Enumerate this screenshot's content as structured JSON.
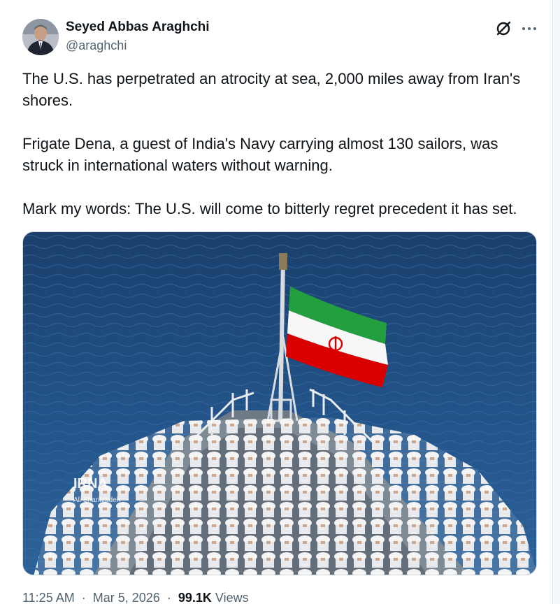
{
  "author": {
    "display_name": "Seyed Abbas Araghchi",
    "handle": "@araghchi",
    "avatar_icon": "profile-photo"
  },
  "actions": {
    "grok_icon": "grok-icon",
    "more_icon": "more-dots-icon"
  },
  "tweet": {
    "paragraphs": [
      "The U.S. has perpetrated an atrocity at sea, 2,000 miles away from Iran's shores.",
      "Frigate Dena, a guest of India's Navy carrying almost 130 sailors, was struck in international waters without warning.",
      "Mark my words: The U.S. will come to bitterly regret precedent it has set."
    ]
  },
  "media": {
    "watermark": "IRNA",
    "credit": "Ali Sharifzadeh"
  },
  "meta": {
    "time": "11:25 AM",
    "separator": "·",
    "date": "Mar 5, 2026",
    "views_count": "99.1K",
    "views_label": "Views"
  },
  "colors": {
    "text": "#0f1419",
    "secondary": "#536471",
    "sea": "#1f4a7a",
    "flag_green": "#239f40",
    "flag_red": "#da0000"
  }
}
